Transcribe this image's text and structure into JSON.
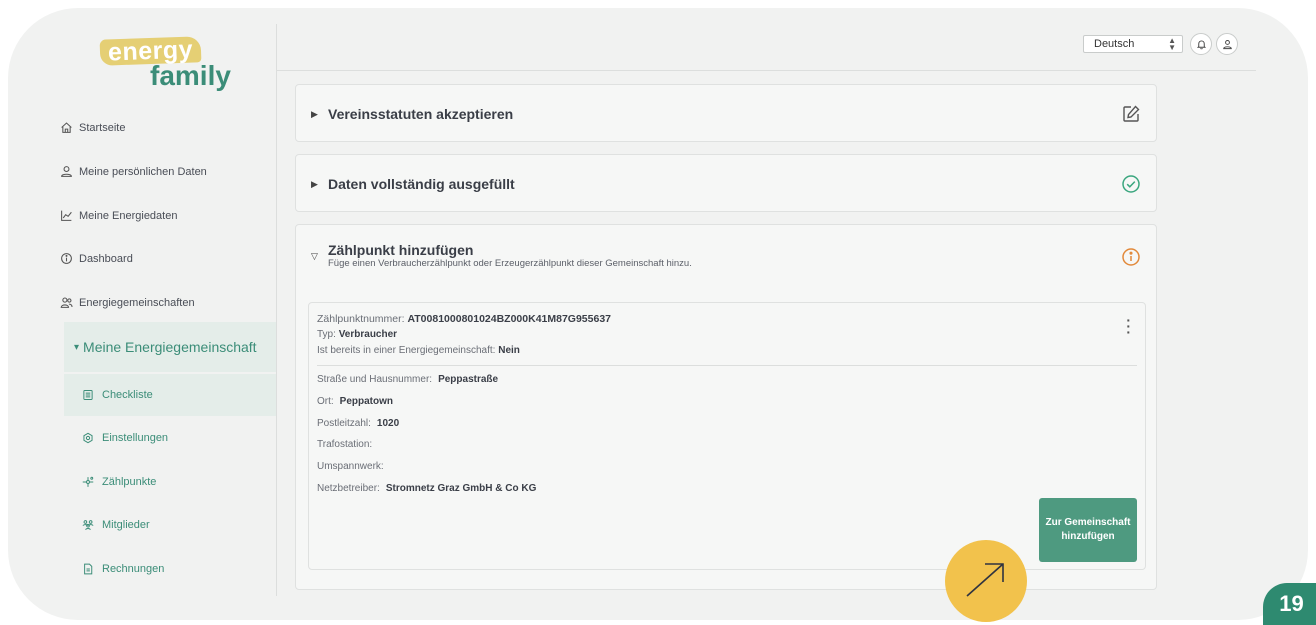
{
  "logo": {
    "top": "energy",
    "bottom": "family"
  },
  "sidebar": {
    "items": [
      {
        "label": "Startseite",
        "icon": "home-icon"
      },
      {
        "label": "Meine persönlichen Daten",
        "icon": "user-icon"
      },
      {
        "label": "Meine Energiedaten",
        "icon": "chart-line-icon"
      },
      {
        "label": "Dashboard",
        "icon": "info-circle-icon"
      },
      {
        "label": "Energiegemeinschaften",
        "icon": "users-icon"
      }
    ],
    "group": {
      "label": "Meine Energiegemeinschaft",
      "expanded": true
    },
    "subitems": [
      {
        "label": "Checkliste",
        "icon": "checklist-icon",
        "active": true
      },
      {
        "label": "Einstellungen",
        "icon": "gear-icon"
      },
      {
        "label": "Zählpunkte",
        "icon": "meter-icon"
      },
      {
        "label": "Mitglieder",
        "icon": "members-icon"
      },
      {
        "label": "Rechnungen",
        "icon": "invoice-icon"
      }
    ]
  },
  "topbar": {
    "language": "Deutsch",
    "icons": [
      "bell-icon",
      "profile-icon"
    ]
  },
  "checklist": [
    {
      "title": "Vereinsstatuten akzeptieren",
      "status": "edit",
      "status_icon": "edit-icon"
    },
    {
      "title": "Daten vollständig ausgefüllt",
      "status": "done",
      "status_icon": "check-circle-icon"
    },
    {
      "title": "Zählpunkt hinzufügen",
      "subtitle": "Füge einen Verbraucherzählpunkt oder Erzeugerzählpunkt dieser Gemeinschaft hinzu.",
      "status": "info",
      "status_icon": "info-icon"
    }
  ],
  "meter": {
    "number_label": "Zählpunktnummer:",
    "number": "AT0081000801024BZ000K41M87G955637",
    "type_label": "Typ:",
    "type": "Verbraucher",
    "community_label": "Ist bereits in einer Energiegemeinschaft:",
    "community": "Nein",
    "street_label": "Straße und Hausnummer:",
    "street": "Peppastraße",
    "city_label": "Ort:",
    "city": "Peppatown",
    "zip_label": "Postleitzahl:",
    "zip": "1020",
    "transformer_label": "Trafostation:",
    "transformer": "",
    "substation_label": "Umspannwerk:",
    "substation": "",
    "operator_label": "Netzbetreiber:",
    "operator": "Stromnetz Graz GmbH & Co KG",
    "add_button": "Zur Gemeinschaft hinzufügen"
  },
  "page_number": "19",
  "colors": {
    "accent": "#3b8d78",
    "button": "#4e9a80",
    "success": "#3aa67e",
    "warning": "#e2893a",
    "hint": "#f2c24c",
    "logo_yellow": "#e5cf74"
  }
}
